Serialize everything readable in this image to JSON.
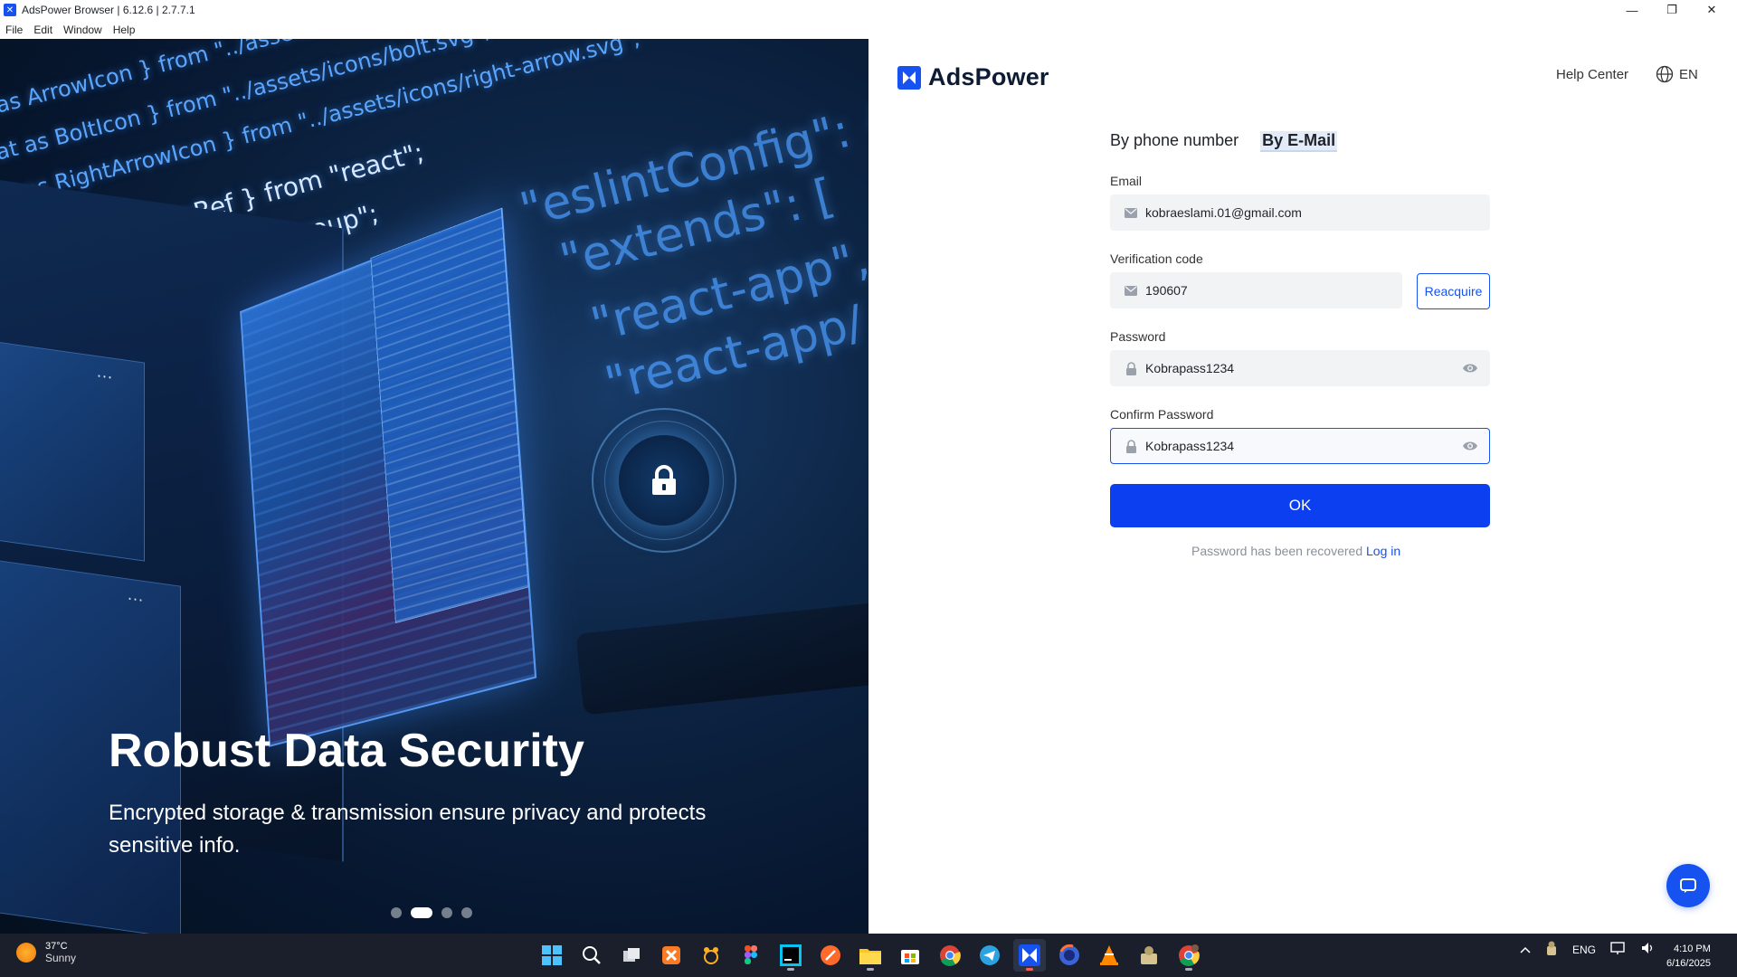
{
  "window": {
    "title": "AdsPower Browser | 6.12.6 | 2.7.7.1"
  },
  "menu": [
    "File",
    "Edit",
    "Window",
    "Help"
  ],
  "hero": {
    "code_lines": [
      "as ArrowIcon } from \"../assets/icons/arrow.svg\";",
      "at as BoltIcon } from \"../assets/icons/bolt.svg\";",
      "nt as RightArrowIcon } from \"../assets/icons/right-arrow.svg\";",
      "e, useEffect, useRef } from \"react\";",
      "} from \"react-transition-group\";"
    ],
    "config_lines": [
      "\"eslintConfig\": {",
      "\"extends\": [",
      "\"react-app\",",
      "\"react-app/"
    ],
    "panel_dots": "...",
    "title": "Robust Data Security",
    "subtitle": "Encrypted storage & transmission ensure privacy and protects sensitive info.",
    "carousel_active_index": 1,
    "carousel_count": 4
  },
  "brand": {
    "name": "AdsPower"
  },
  "header": {
    "help": "Help Center",
    "lang": "EN"
  },
  "tabs": [
    {
      "label": "By phone number",
      "active": false
    },
    {
      "label": "By E-Mail",
      "active": true
    }
  ],
  "form": {
    "email_label": "Email",
    "email_value": "kobraeslami.01@gmail.com",
    "code_label": "Verification code",
    "code_value": "190607",
    "reacquire": "Reacquire",
    "password_label": "Password",
    "password_value": "Kobrapass1234",
    "confirm_label": "Confirm Password",
    "confirm_value": "Kobrapass1234",
    "ok": "OK",
    "recover_text": "Password has been recovered",
    "login_link": "Log in"
  },
  "taskbar": {
    "weather_temp": "37°C",
    "weather_desc": "Sunny",
    "apps": [
      "windows-start",
      "search",
      "task-view",
      "xampp",
      "animal-app",
      "figma",
      "webstorm",
      "code-editor",
      "file-explorer",
      "microsoft-store",
      "chrome",
      "telegram",
      "adspower",
      "firefox",
      "vlc",
      "network-app",
      "chrome-profile"
    ],
    "tray_lang": "ENG",
    "time": "4:10 PM",
    "date": "6/16/2025"
  },
  "colors": {
    "accent": "#1652f0",
    "ok_button": "#0b3ff0",
    "taskbar": "#1a1f2b"
  }
}
